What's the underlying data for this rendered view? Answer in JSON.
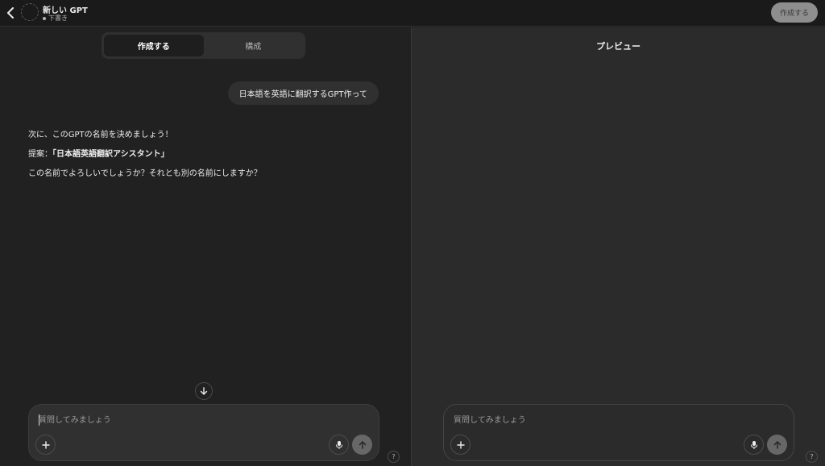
{
  "header": {
    "title": "新しい GPT",
    "status": "下書き",
    "create_button": "作成する"
  },
  "tabs": [
    {
      "label": "作成する",
      "active": true
    },
    {
      "label": "構成",
      "active": false
    }
  ],
  "chat": {
    "user_message": "日本語を英語に翻訳するGPT作って",
    "assistant": {
      "line1": "次に、このGPTの名前を決めましょう！",
      "line2_prefix": "提案：",
      "line2_name": "「日本語英語翻訳アシスタント」",
      "line3": "この名前でよろしいでしょうか？それとも別の名前にしますか？"
    }
  },
  "composer": {
    "placeholder": "質問してみましょう"
  },
  "preview": {
    "title": "プレビュー",
    "placeholder": "質問してみましょう"
  },
  "help_label": "?",
  "colors": {
    "background": "#212121",
    "preview_background": "#2b2b2b",
    "bubble": "#303030",
    "send_button": "#676767"
  }
}
